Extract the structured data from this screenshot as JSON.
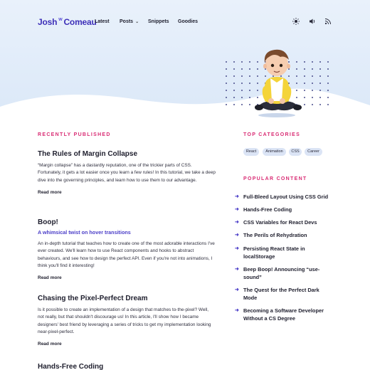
{
  "nav": {
    "logo_first": "Josh",
    "logo_sep": "w",
    "logo_last": "Comeau",
    "links": [
      {
        "label": "Latest"
      },
      {
        "label": "Posts",
        "has_dropdown": true
      },
      {
        "label": "Snippets"
      },
      {
        "label": "Goodies"
      }
    ],
    "icons": [
      "sun-icon",
      "sound-icon",
      "rss-icon"
    ]
  },
  "recent": {
    "heading": "RECENTLY PUBLISHED",
    "posts": [
      {
        "title": "The Rules of Margin Collapse",
        "subtitle": "",
        "body": "“Margin collapse” has a dastardly reputation, one of the trickier parts of CSS. Fortunately, it gets a lot easier once you learn a few rules! In this tutorial, we take a deep dive into the governing principles, and learn how to use them to our advantage.",
        "read_more": "Read more"
      },
      {
        "title": "Boop!",
        "subtitle": "A whimsical twist on hover transitions",
        "body": "An in-depth tutorial that teaches how to create one of the most adorable interactions I've ever created. We'll learn how to use React components and hooks to abstract behaviours, and see how to design the perfect API. Even if you're not into animations, I think you'll find it interesting!",
        "read_more": "Read more"
      },
      {
        "title": "Chasing the Pixel-Perfect Dream",
        "subtitle": "",
        "body": "Is it possible to create an implementation of a design that matches to-the-pixel? Well, not really, but that shouldn't discourage us! In this article, I'll show how I became designers' best friend by leveraging a series of tricks to get my implementation looking near-pixel-perfect.",
        "read_more": "Read more"
      },
      {
        "title": "Hands-Free Coding",
        "subtitle": "",
        "body": "",
        "read_more": ""
      }
    ]
  },
  "sidebar": {
    "categories_heading": "TOP CATEGORIES",
    "categories": [
      "React",
      "Animation",
      "CSS",
      "Career"
    ],
    "popular_heading": "POPULAR CONTENT",
    "popular": [
      "Full-Bleed Layout Using CSS Grid",
      "Hands-Free Coding",
      "CSS Variables for React Devs",
      "The Perils of Rehydration",
      "Persisting React State in localStorage",
      "Beep Boop! Announcing “use-sound”",
      "The Quest for the Perfect Dark Mode",
      "Becoming a Software Developer Without a CS Degree"
    ]
  },
  "colors": {
    "accent_pink": "#d92c74",
    "accent_purple": "#4b3ec8",
    "hero_bg": "#dbe8f8"
  }
}
